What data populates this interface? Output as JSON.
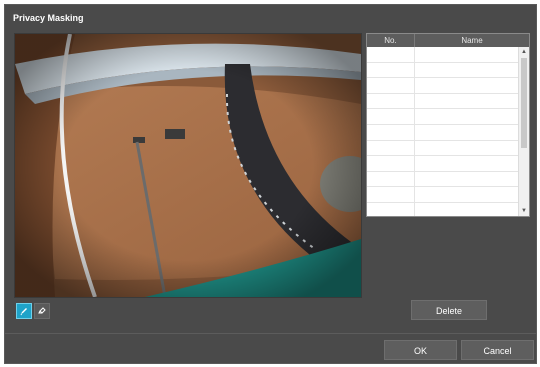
{
  "dialog": {
    "title": "Privacy Masking"
  },
  "toolbar": {
    "tools": [
      {
        "icon": "pencil-icon",
        "active": true
      },
      {
        "icon": "eraser-icon",
        "active": false
      }
    ]
  },
  "mask_table": {
    "columns": [
      "No.",
      "Name"
    ],
    "rows": []
  },
  "buttons": {
    "delete": "Delete",
    "ok": "OK",
    "cancel": "Cancel"
  },
  "colors": {
    "background": "#4a4a4a",
    "accent": "#1fa3c9"
  }
}
